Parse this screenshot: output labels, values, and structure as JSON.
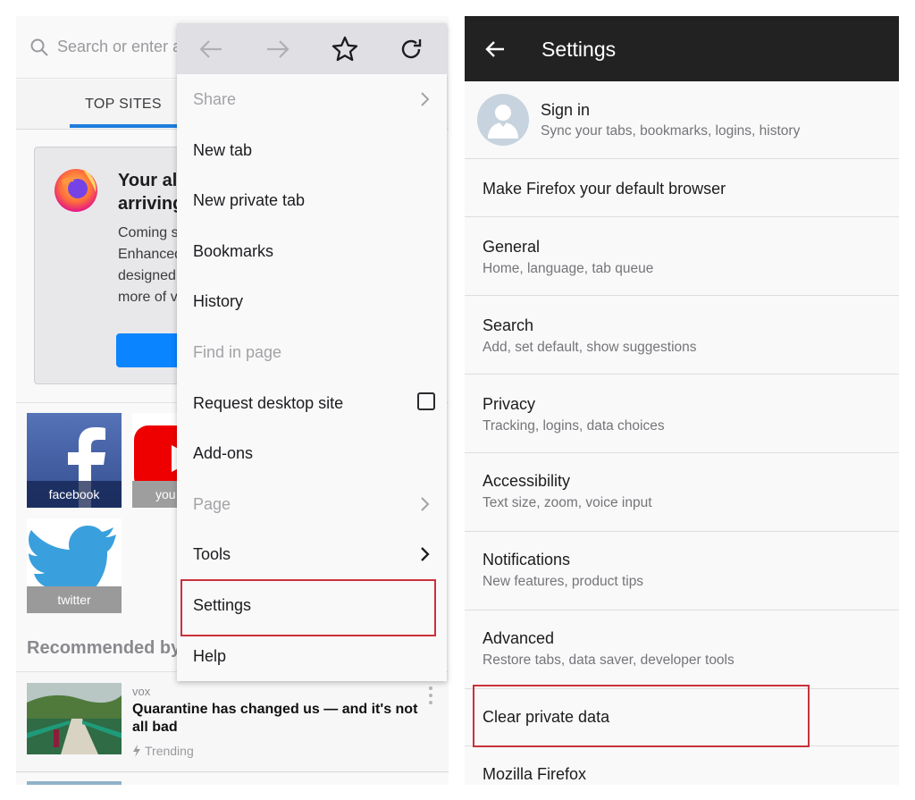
{
  "left_screen": {
    "url_bar": {
      "placeholder": "Search or enter a",
      "search_icon": "search-icon"
    },
    "tabs": [
      {
        "label": "TOP SITES",
        "active": true
      }
    ],
    "accent_color": "#1e7ddb",
    "promo_card": {
      "title": "Your al\narriving",
      "body": "Coming s\nEnhanced\ndesigned\nmore of v",
      "logo": "firefox-logo",
      "button_color": "#0a84ff"
    },
    "top_sites": [
      {
        "label": "facebook",
        "icon": "facebook-icon"
      },
      {
        "label": "you",
        "icon": "youtube-icon"
      },
      {
        "label": "twitter",
        "icon": "twitter-icon"
      }
    ],
    "recommended": {
      "title": "Recommended by",
      "stories": [
        {
          "source": "vox",
          "headline": "Quarantine has changed us — and it's not all bad",
          "tag": "Trending"
        }
      ]
    },
    "menu": {
      "toolbar": [
        {
          "icon": "back-arrow-icon",
          "enabled": false
        },
        {
          "icon": "forward-arrow-icon",
          "enabled": false
        },
        {
          "icon": "star-bookmark-icon",
          "enabled": true
        },
        {
          "icon": "reload-icon",
          "enabled": true
        }
      ],
      "items": [
        {
          "label": "Share",
          "enabled": false,
          "submenu": true
        },
        {
          "label": "New tab",
          "enabled": true
        },
        {
          "label": "New private tab",
          "enabled": true
        },
        {
          "label": "Bookmarks",
          "enabled": true
        },
        {
          "label": "History",
          "enabled": true
        },
        {
          "label": "Find in page",
          "enabled": false
        },
        {
          "label": "Request desktop site",
          "enabled": true,
          "checkbox": false
        },
        {
          "label": "Add-ons",
          "enabled": true
        },
        {
          "label": "Page",
          "enabled": false,
          "submenu": true
        },
        {
          "label": "Tools",
          "enabled": true,
          "submenu": true
        },
        {
          "label": "Settings",
          "enabled": true,
          "highlighted": true
        },
        {
          "label": "Help",
          "enabled": true
        }
      ],
      "highlight_color": "#c9323a"
    }
  },
  "right_screen": {
    "app_bar": {
      "title": "Settings",
      "back_icon": "back-arrow-icon",
      "background": "#222222"
    },
    "sign_in": {
      "title": "Sign in",
      "subtitle": "Sync your tabs, bookmarks, logins, history"
    },
    "rows": [
      {
        "title": "Make Firefox your default browser",
        "subtitle": ""
      },
      {
        "title": "General",
        "subtitle": "Home, language, tab queue"
      },
      {
        "title": "Search",
        "subtitle": "Add, set default, show suggestions"
      },
      {
        "title": "Privacy",
        "subtitle": "Tracking, logins, data choices"
      },
      {
        "title": "Accessibility",
        "subtitle": "Text size, zoom, voice input"
      },
      {
        "title": "Notifications",
        "subtitle": "New features, product tips"
      },
      {
        "title": "Advanced",
        "subtitle": "Restore tabs, data saver, developer tools"
      },
      {
        "title": "Clear private data",
        "subtitle": "",
        "highlighted": true
      },
      {
        "title": "Mozilla Firefox",
        "subtitle": ""
      }
    ]
  }
}
